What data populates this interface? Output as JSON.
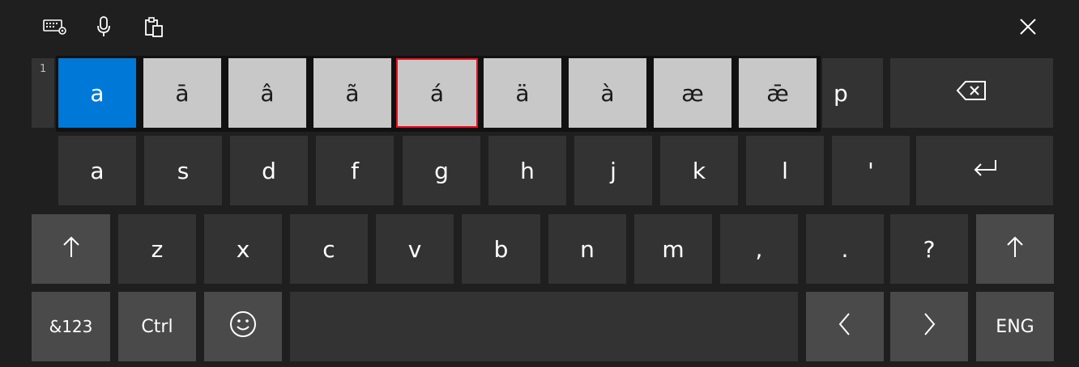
{
  "toolbar": {
    "icons": [
      "keyboard-settings-icon",
      "microphone-icon",
      "clipboard-icon",
      "close-icon"
    ]
  },
  "accent_popup": {
    "index_label": "1",
    "options": [
      "a",
      "ā",
      "â",
      "ã",
      "á",
      "ä",
      "à",
      "æ",
      "ǣ"
    ],
    "selected_index": 0,
    "focused_index": 4
  },
  "row1": {
    "p": "p",
    "backspace": "backspace-icon"
  },
  "row2": {
    "keys": [
      "a",
      "s",
      "d",
      "f",
      "g",
      "h",
      "j",
      "k",
      "l",
      "'"
    ],
    "enter": "enter-icon"
  },
  "row3": {
    "keys": [
      "z",
      "x",
      "c",
      "v",
      "b",
      "n",
      "m",
      ",",
      ".",
      "?"
    ],
    "shift": "shift-icon"
  },
  "row4": {
    "symbols": "&123",
    "ctrl": "Ctrl",
    "emoji": "emoji-icon",
    "left": "left-arrow-icon",
    "right": "right-arrow-icon",
    "language": "ENG"
  },
  "colors": {
    "background": "#1f1f1f",
    "key": "#333333",
    "key_alt": "#4a4a4a",
    "accent_option": "#c8c8c8",
    "selected": "#0078d7",
    "focus_border": "#e81123"
  }
}
